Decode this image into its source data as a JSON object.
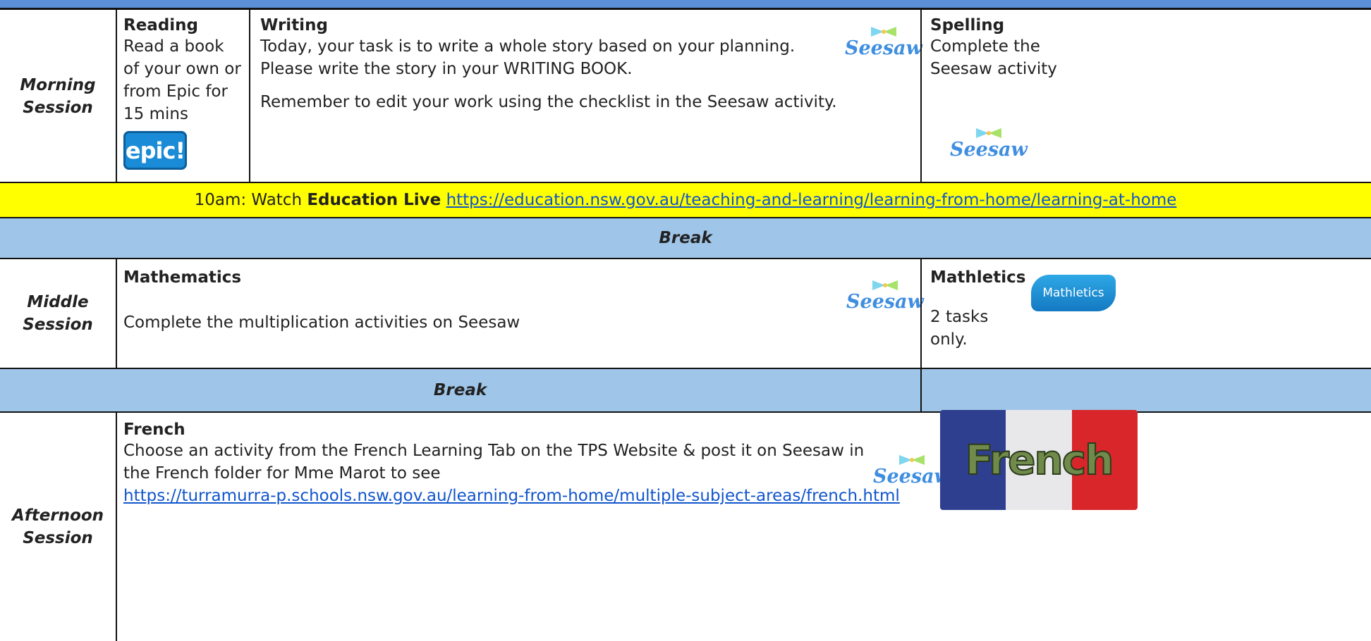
{
  "morning": {
    "session_label": [
      "Morning",
      "Session"
    ],
    "reading": {
      "title": "Reading",
      "lines": [
        "Read a book",
        "of your own or",
        "from Epic for",
        "15 mins"
      ],
      "logo": "epic!"
    },
    "writing": {
      "title": "Writing",
      "line1": "Today, your task is to write a whole story based on your planning.",
      "line2": "Please write the story in your WRITING BOOK.",
      "line3": "Remember to edit your work using the checklist in the Seesaw activity.",
      "logo": "Seesaw"
    },
    "spelling": {
      "title": "Spelling",
      "lines": [
        "Complete the",
        "Seesaw activity"
      ],
      "logo": "Seesaw"
    }
  },
  "banner": {
    "prefix": "10am: Watch ",
    "bold": "Education Live",
    "link": "https://education.nsw.gov.au/teaching-and-learning/learning-from-home/learning-at-home"
  },
  "break1": "Break",
  "middle": {
    "session_label": [
      "Middle",
      "Session"
    ],
    "maths": {
      "title": "Mathematics",
      "text": "Complete the multiplication activities on Seesaw",
      "logo": "Seesaw"
    },
    "mathletics": {
      "title": "Mathletics",
      "lines": [
        "2 tasks",
        "only."
      ],
      "logo": "Mathletics"
    }
  },
  "break2": "Break",
  "afternoon": {
    "session_label": [
      "Afternoon",
      "Session"
    ],
    "french": {
      "title": "French",
      "line1": "Choose an activity from the French Learning Tab on the TPS Website & post it on Seesaw in",
      "line2": "the French folder for Mme Marot to see",
      "link": "https://turramurra-p.schools.nsw.gov.au/learning-from-home/multiple-subject-areas/french.html",
      "logo": "Seesaw",
      "image_text": "French"
    }
  },
  "colors": {
    "header_blue": "#5b8fd6",
    "band_blue": "#9fc5e8",
    "banner_yellow": "#ffff00",
    "link": "#1155cc",
    "seesaw": "#3f8ee0"
  }
}
